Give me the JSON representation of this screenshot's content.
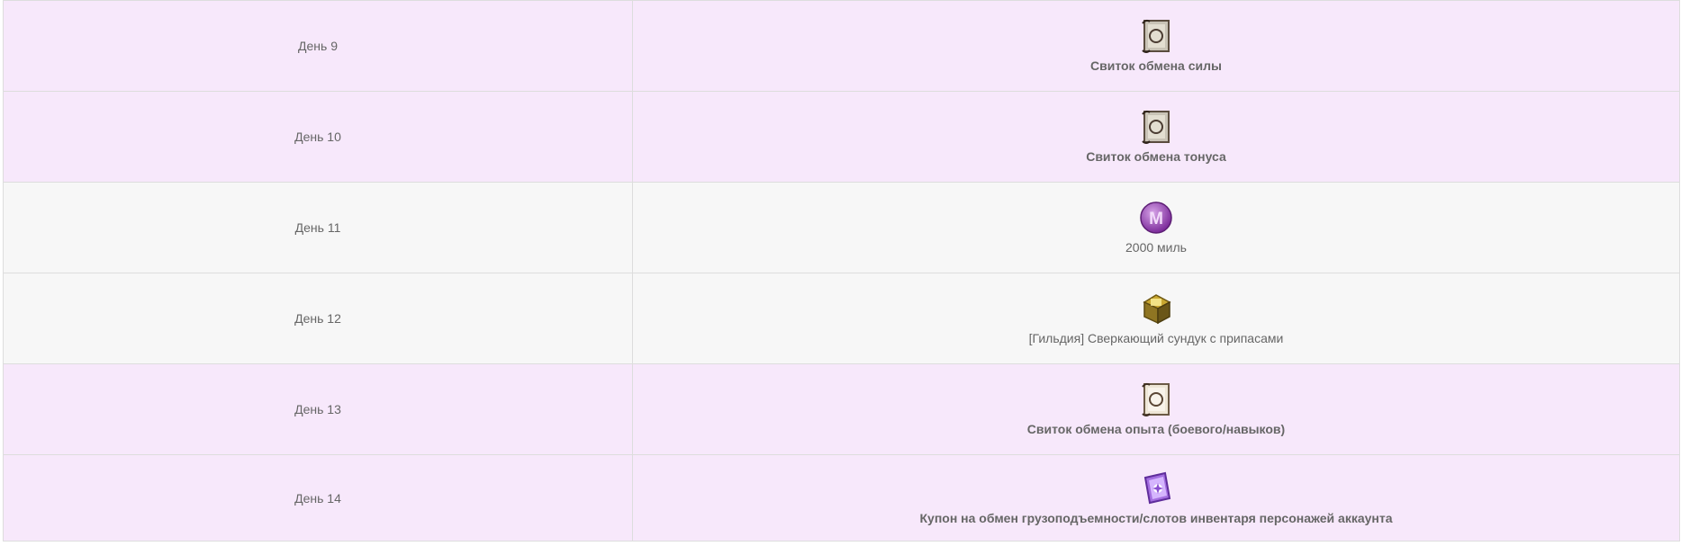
{
  "rows": [
    {
      "day": "День 9",
      "icon": "scroll-icon",
      "item": "Свиток обмена силы",
      "bold": true,
      "style": "purple"
    },
    {
      "day": "День 10",
      "icon": "scroll-icon",
      "item": "Свиток обмена тонуса",
      "bold": true,
      "style": "purple"
    },
    {
      "day": "День 11",
      "icon": "mile-coin-icon",
      "item": "2000 миль",
      "bold": false,
      "style": "gray"
    },
    {
      "day": "День 12",
      "icon": "treasure-chest-icon",
      "item": "[Гильдия] Сверкающий сундук с припасами",
      "bold": false,
      "style": "gray"
    },
    {
      "day": "День 13",
      "icon": "light-scroll-icon",
      "item": "Свиток обмена опыта (боевого/навыков)",
      "bold": true,
      "style": "purple"
    },
    {
      "day": "День 14",
      "icon": "coupon-icon",
      "item": "Купон на обмен грузоподъемности/слотов инвентаря персонажей аккаунта",
      "bold": true,
      "style": "purple"
    }
  ],
  "colors": {
    "purple_row": "#f7e8fb",
    "gray_row": "#f7f7f7",
    "text": "#666666",
    "border": "#dddddd"
  }
}
